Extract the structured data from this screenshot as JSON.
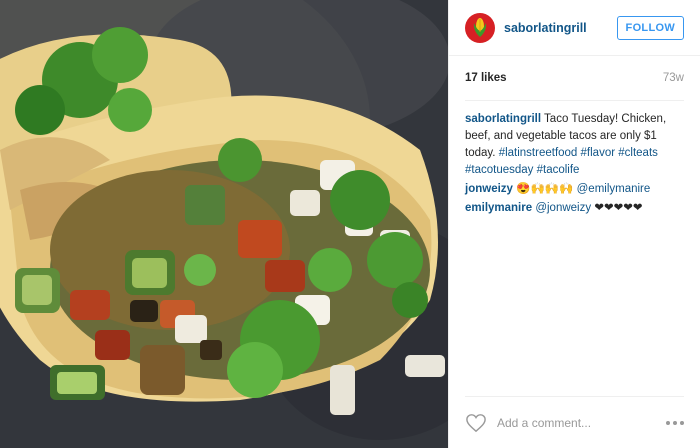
{
  "post": {
    "username": "saborlatingrill",
    "follow_label": "FOLLOW",
    "likes": "17 likes",
    "time_ago": "73w",
    "caption": {
      "user": "saborlatingrill",
      "text": "Taco Tuesday! Chicken, beef, and vegetable tacos are only $1 today.",
      "hashtags": [
        "#latinstreetfood",
        "#flavor",
        "#clteats",
        "#tacotuesday",
        "#tacolife"
      ]
    },
    "comments": [
      {
        "user": "jonweizy",
        "emoji": "😍🙌🙌🙌",
        "mention": "@emilymanire"
      },
      {
        "user": "emilymanire",
        "mention": "@jonweizy",
        "emoji": "❤❤❤❤❤"
      }
    ],
    "add_comment_placeholder": "Add a comment..."
  },
  "icons": {
    "avatar": "corn-logo-icon",
    "like": "heart-outline-icon",
    "more": "ellipsis-icon"
  },
  "colors": {
    "link_blue": "#125688",
    "follow_blue": "#3897f0",
    "avatar_red": "#d62024",
    "muted": "#999999"
  }
}
